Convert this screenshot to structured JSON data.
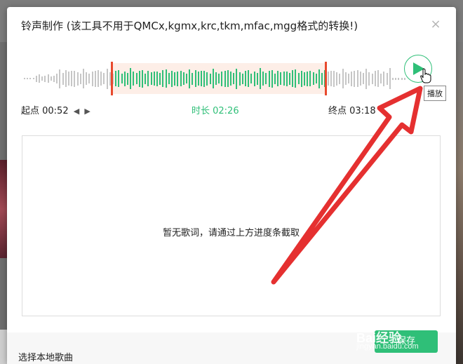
{
  "dialog": {
    "title": "铃声制作 (该工具不用于QMCx,kgmx,krc,tkm,mfac,mgg格式的转换!)",
    "close_label": "×"
  },
  "waveform": {
    "selection_start_fraction": 0.235,
    "selection_end_fraction": 0.79
  },
  "play": {
    "tooltip": "播放"
  },
  "times": {
    "start_label": "起点 00:52",
    "duration_label": "时长 02:26",
    "end_label": "终点  03:18"
  },
  "lyrics": {
    "empty_text": "暂无歌词，请通过上方进度条截取"
  },
  "footer": {
    "local_song_label": "选择本地歌曲",
    "save_label": "保存"
  },
  "watermark": {
    "brand": "Bai经验",
    "url": "jingyan.baidu.com"
  },
  "colors": {
    "accent": "#2fbf78",
    "handle": "#e8492d",
    "annotation": "#e53030"
  }
}
